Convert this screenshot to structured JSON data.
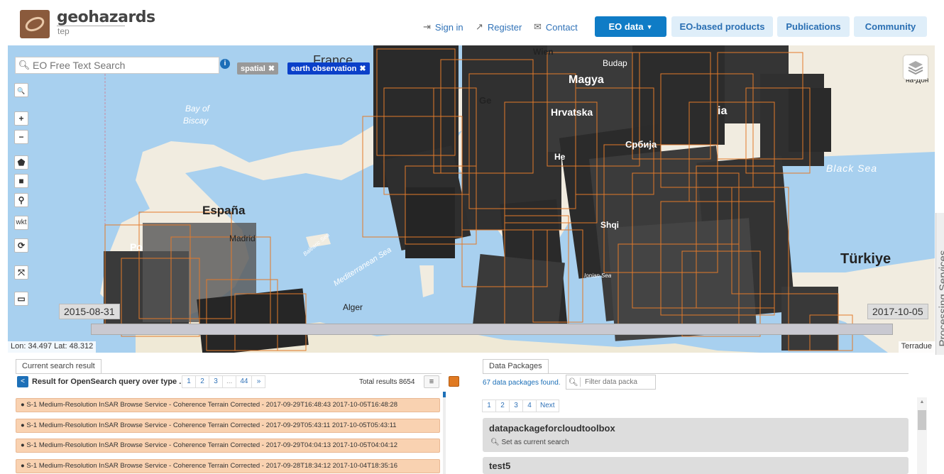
{
  "header": {
    "brand": "geohazards",
    "brand_sub": "tep",
    "links": {
      "signin": "Sign in",
      "register": "Register",
      "contact": "Contact"
    },
    "nav": {
      "eo_data": "EO data",
      "eo_products": "EO-based products",
      "publications": "Publications",
      "community": "Community"
    }
  },
  "map": {
    "search_placeholder": "EO Free Text Search",
    "tags": {
      "spatial": "spatial",
      "eo": "earth observation"
    },
    "tools": {
      "search": "🔍",
      "zoom_in": "+",
      "zoom_out": "−",
      "polygon": "⬟",
      "square": "■",
      "marker": "⚲",
      "wkt": "wkt",
      "refresh": "⟳",
      "expand": "⤧",
      "erase": "▭"
    },
    "labels": {
      "france": "France",
      "bay": "Bay of",
      "biscay": "Biscay",
      "espana": "España",
      "madrid": "Madrid",
      "alger": "Alger",
      "med": "Mediterranean Sea",
      "balearic": "Balearic Sea",
      "magya": "Magya",
      "hrvatska": "Hrvatska",
      "srbija": "Србија",
      "shqi": "Shqi",
      "black_sea": "Black Sea",
      "turkiye": "Türkiye",
      "ionian": "Ionian Sea",
      "wien": "Wien",
      "budap": "Budap",
      "ge": "Ge",
      "po": "Po",
      "ia": "ia",
      "he": "He",
      "na_don": "на-Дон"
    },
    "date_start": "2015-08-31",
    "date_end": "2017-10-05",
    "coords": "Lon: 34.497 Lat: 48.312",
    "attribution": "Terradue",
    "side_tab": "Processing Services"
  },
  "results": {
    "tab": "Current search result",
    "query": "Result for OpenSearch query over type ...",
    "pages": [
      "1",
      "2",
      "3",
      "...",
      "44",
      "»"
    ],
    "total": "Total results  8654",
    "rows": [
      "S-1 Medium-Resolution InSAR Browse Service - Coherence Terrain Corrected - 2017-09-29T16:48:43 2017-10-05T16:48:28",
      "S-1 Medium-Resolution InSAR Browse Service - Coherence Terrain Corrected - 2017-09-29T05:43:11 2017-10-05T05:43:11",
      "S-1 Medium-Resolution InSAR Browse Service - Coherence Terrain Corrected - 2017-09-29T04:04:13 2017-10-05T04:04:12",
      "S-1 Medium-Resolution InSAR Browse Service - Coherence Terrain Corrected - 2017-09-28T18:34:12 2017-10-04T18:35:16"
    ]
  },
  "packages": {
    "tab": "Data Packages",
    "count": "67 data packages found.",
    "filter_placeholder": "Filter data packa",
    "pages": [
      "1",
      "2",
      "3",
      "4",
      "Next"
    ],
    "items": [
      {
        "name": "datapackageforcloudtoolbox",
        "action": "Set as current search"
      },
      {
        "name": "test5"
      }
    ]
  }
}
